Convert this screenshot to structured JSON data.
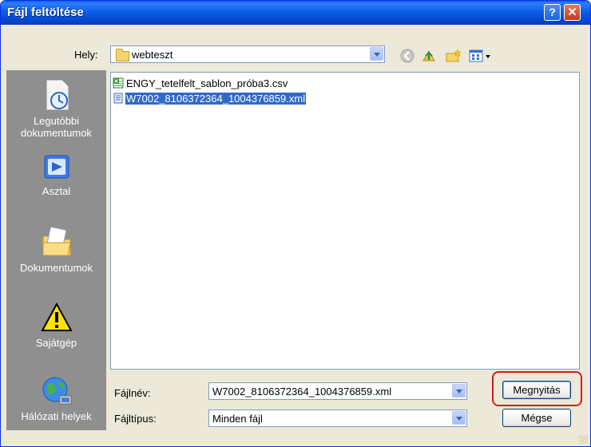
{
  "window": {
    "title": "Fájl feltöltése",
    "help_glyph": "?",
    "close_glyph": "✕"
  },
  "location": {
    "label": "Hely:",
    "value": "webteszt"
  },
  "places": [
    {
      "label": "Legutóbbi dokumentumok",
      "icon": "recent-documents-icon"
    },
    {
      "label": "Asztal",
      "icon": "desktop-icon"
    },
    {
      "label": "Dokumentumok",
      "icon": "my-documents-icon"
    },
    {
      "label": "Sajátgép",
      "icon": "warning-icon"
    },
    {
      "label": "Hálózati helyek",
      "icon": "network-places-icon"
    }
  ],
  "files": [
    {
      "name": "ENGY_tetelfelt_sablon_próba3.csv",
      "selected": false,
      "icon": "excel-csv-icon"
    },
    {
      "name": "W7002_8106372364_1004376859.xml",
      "selected": true,
      "icon": "xml-file-icon"
    }
  ],
  "filename": {
    "label": "Fájlnév:",
    "value": "W7002_8106372364_1004376859.xml"
  },
  "filetype": {
    "label": "Fájltípus:",
    "value": "Minden fájl"
  },
  "buttons": {
    "open": "Megnyitás",
    "cancel": "Mégse"
  },
  "colors": {
    "title_bar": "#0a5fe6",
    "selection": "#316ac5",
    "highlight_outline": "#d91a1a",
    "places_bar": "#8f8f8f"
  }
}
